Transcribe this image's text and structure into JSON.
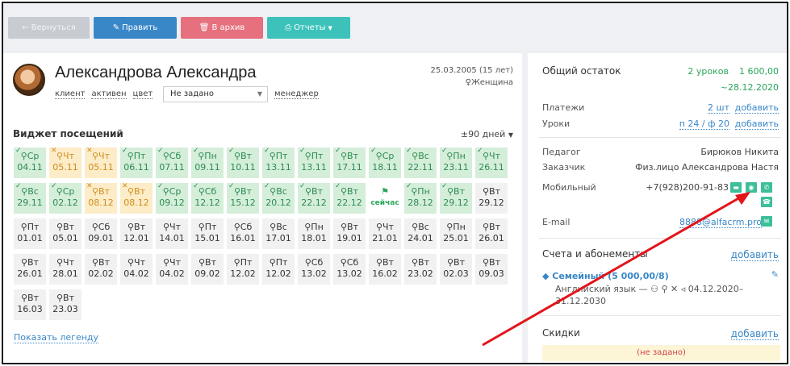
{
  "toolbar": {
    "back_label": "Вернуться",
    "edit_label": "Править",
    "archive_label": "В архив",
    "reports_label": "Отчеты"
  },
  "client": {
    "name": "Александрова Александра",
    "tags": [
      "клиент",
      "активен",
      "цвет"
    ],
    "select_value": "Не задано",
    "manager_label": "менеджер",
    "birth": "25.03.2005 (15 лет)",
    "gender": "Женщина"
  },
  "widget": {
    "title": "Виджет посещений",
    "range": "±90 дней",
    "legend_link": "Показать легенду",
    "rows": [
      [
        {
          "d": "Ср",
          "n": "04.11",
          "s": "green"
        },
        {
          "d": "Чт",
          "n": "05.11",
          "s": "yellow"
        },
        {
          "d": "Чт",
          "n": "05.11",
          "s": "yellow"
        },
        {
          "d": "Пт",
          "n": "06.11",
          "s": "green"
        },
        {
          "d": "Сб",
          "n": "07.11",
          "s": "green"
        },
        {
          "d": "Пн",
          "n": "09.11",
          "s": "green"
        },
        {
          "d": "Вт",
          "n": "10.11",
          "s": "green"
        },
        {
          "d": "Пт",
          "n": "13.11",
          "s": "green"
        },
        {
          "d": "Пт",
          "n": "13.11",
          "s": "green"
        },
        {
          "d": "Вт",
          "n": "17.11",
          "s": "green"
        },
        {
          "d": "Ср",
          "n": "18.11",
          "s": "green"
        },
        {
          "d": "Вс",
          "n": "22.11",
          "s": "green"
        },
        {
          "d": "Пн",
          "n": "23.11",
          "s": "green"
        },
        {
          "d": "Чт",
          "n": "26.11",
          "s": "green"
        }
      ],
      [
        {
          "d": "Вс",
          "n": "29.11",
          "s": "green"
        },
        {
          "d": "Ср",
          "n": "02.12",
          "s": "green"
        },
        {
          "d": "Вт",
          "n": "08.12",
          "s": "yellow"
        },
        {
          "d": "Вт",
          "n": "08.12",
          "s": "yellow"
        },
        {
          "d": "Ср",
          "n": "09.12",
          "s": "green"
        },
        {
          "d": "Сб",
          "n": "12.12",
          "s": "green"
        },
        {
          "d": "Вт",
          "n": "15.12",
          "s": "green"
        },
        {
          "d": "Вс",
          "n": "20.12",
          "s": "green"
        },
        {
          "d": "Вт",
          "n": "22.12",
          "s": "green"
        },
        {
          "d": "Вт",
          "n": "22.12",
          "s": "green"
        },
        {
          "d": "",
          "n": "сейчас",
          "s": "now"
        },
        {
          "d": "Пн",
          "n": "28.12",
          "s": "green"
        },
        {
          "d": "Вт",
          "n": "29.12",
          "s": "green"
        },
        {
          "d": "Вт",
          "n": "29.12",
          "s": "gray"
        }
      ],
      [
        {
          "d": "Пт",
          "n": "01.01",
          "s": "gray"
        },
        {
          "d": "Вт",
          "n": "05.01",
          "s": "gray"
        },
        {
          "d": "Сб",
          "n": "09.01",
          "s": "gray"
        },
        {
          "d": "Вт",
          "n": "12.01",
          "s": "gray"
        },
        {
          "d": "Чт",
          "n": "14.01",
          "s": "gray"
        },
        {
          "d": "Пт",
          "n": "15.01",
          "s": "gray"
        },
        {
          "d": "Сб",
          "n": "16.01",
          "s": "gray"
        },
        {
          "d": "Вс",
          "n": "17.01",
          "s": "gray"
        },
        {
          "d": "Пн",
          "n": "18.01",
          "s": "gray"
        },
        {
          "d": "Вт",
          "n": "19.01",
          "s": "gray"
        },
        {
          "d": "Чт",
          "n": "21.01",
          "s": "gray"
        },
        {
          "d": "Вс",
          "n": "24.01",
          "s": "gray"
        },
        {
          "d": "Пн",
          "n": "25.01",
          "s": "gray"
        },
        {
          "d": "Вт",
          "n": "26.01",
          "s": "gray"
        }
      ],
      [
        {
          "d": "Вт",
          "n": "26.01",
          "s": "gray"
        },
        {
          "d": "Чт",
          "n": "28.01",
          "s": "gray"
        },
        {
          "d": "Вт",
          "n": "02.02",
          "s": "gray"
        },
        {
          "d": "Чт",
          "n": "04.02",
          "s": "gray"
        },
        {
          "d": "Чт",
          "n": "04.02",
          "s": "gray"
        },
        {
          "d": "Вт",
          "n": "09.02",
          "s": "gray"
        },
        {
          "d": "Пт",
          "n": "12.02",
          "s": "gray"
        },
        {
          "d": "Пт",
          "n": "12.02",
          "s": "gray"
        },
        {
          "d": "Сб",
          "n": "13.02",
          "s": "gray"
        },
        {
          "d": "Сб",
          "n": "13.02",
          "s": "gray"
        },
        {
          "d": "Вт",
          "n": "16.02",
          "s": "gray"
        },
        {
          "d": "Вт",
          "n": "23.02",
          "s": "gray"
        },
        {
          "d": "Вт",
          "n": "02.03",
          "s": "gray"
        },
        {
          "d": "Вт",
          "n": "09.03",
          "s": "gray"
        }
      ],
      [
        {
          "d": "Вт",
          "n": "16.03",
          "s": "gray"
        },
        {
          "d": "Вт",
          "n": "23.03",
          "s": "gray"
        }
      ]
    ]
  },
  "summary": {
    "balance_label": "Общий остаток",
    "balance_lessons": "2 уроков",
    "balance_sum": "1 600,00",
    "balance_date": "~28.12.2020",
    "payments_label": "Платежи",
    "payments_value": "2 шт",
    "lessons_label": "Уроки",
    "lessons_value": "п 24 / ф 20",
    "add_label": "добавить"
  },
  "contacts": {
    "teacher_label": "Педагог",
    "teacher_value": "Бирюков Никита",
    "customer_label": "Заказчик",
    "customer_value": "Физ.лицо Александрова Настя",
    "mobile_label": "Мобильный",
    "mobile_value": "+7(928)200-91-83",
    "email_label": "E-mail",
    "email_value": "8888@alfacrm.pro"
  },
  "subscriptions": {
    "title": "Счета и абонементы",
    "add_label": "добавить",
    "plan": "Семейный (5 000,00/8)",
    "course": "Английский язык —",
    "period": "04.12.2020–",
    "period_end": "31.12.2030"
  },
  "discounts": {
    "title": "Скидки",
    "add_label": "добавить",
    "empty": "(не задано)"
  },
  "colors": {
    "accent": "#3a87c8",
    "green": "#2aa65a",
    "annotation_arrow": "#e3141b"
  }
}
